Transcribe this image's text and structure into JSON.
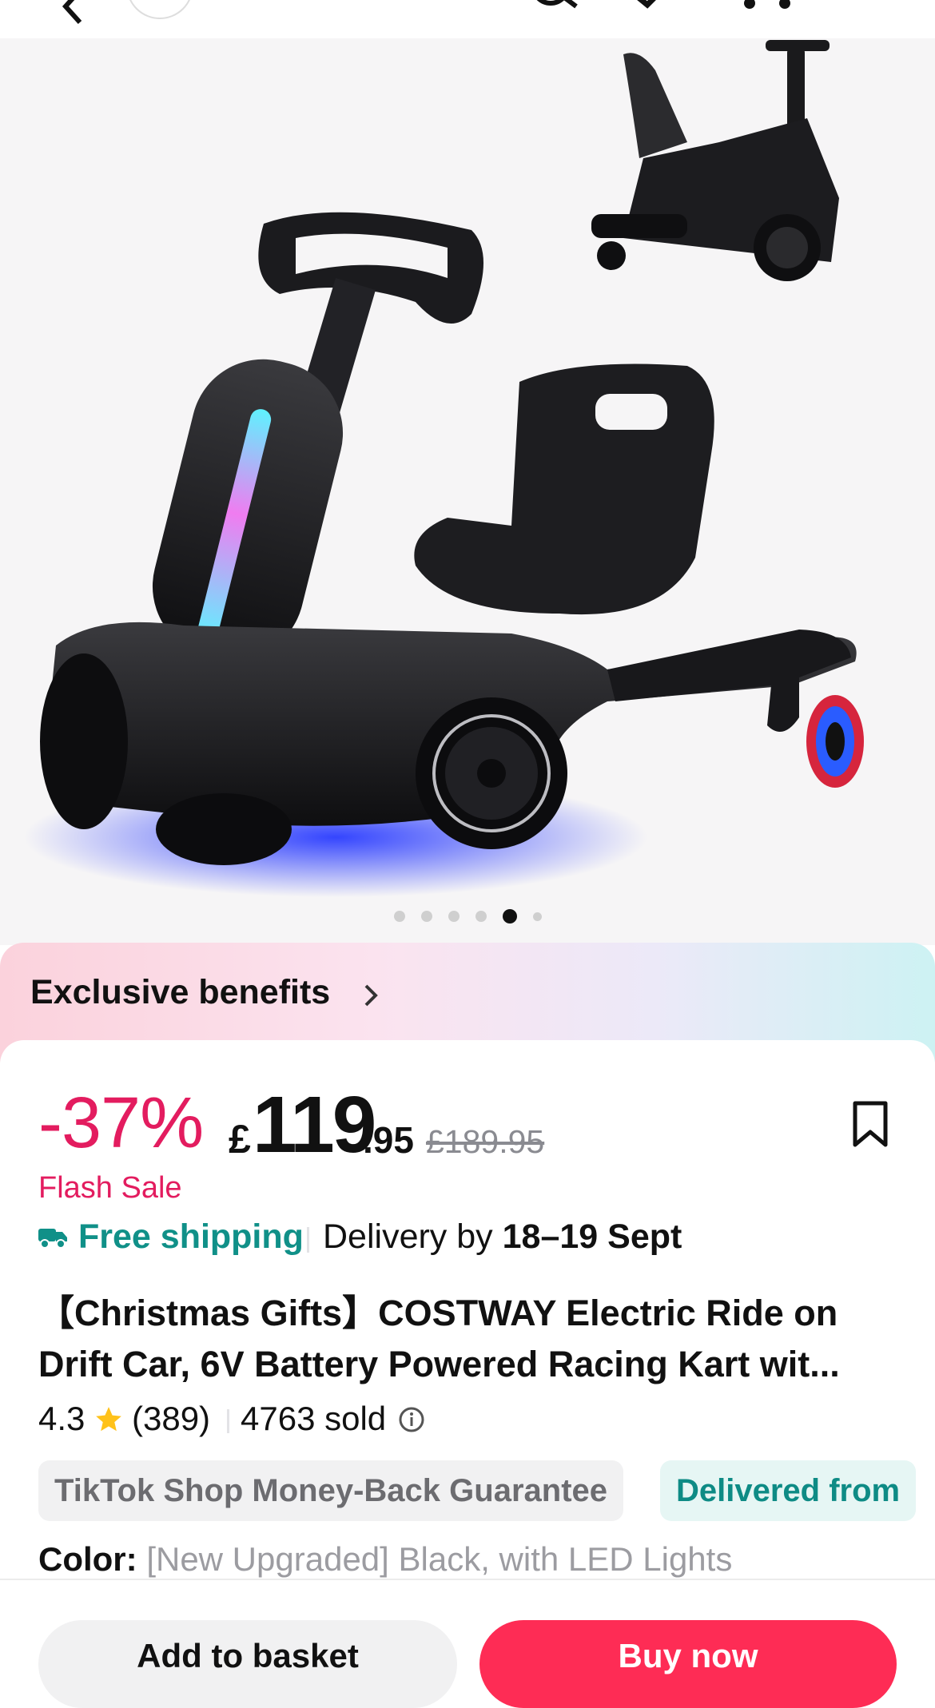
{
  "product": {
    "image_dots": 6,
    "active_dot": 5,
    "benefits_label": "Exclusive benefits",
    "discount": "-37%",
    "currency": "£",
    "price_int": "119",
    "price_dec": ".95",
    "original_price": "£189.95",
    "flash_sale": "Flash Sale",
    "free_shipping": "Free shipping",
    "delivery_prefix": "Delivery by ",
    "delivery_dates": "18–19 Sept",
    "title": "【Christmas Gifts】COSTWAY Electric Ride on Drift Car, 6V Battery Powered Racing Kart wit...",
    "rating": "4.3",
    "reviews": "(389)",
    "sold": "4763 sold",
    "tag_guarantee": "TikTok Shop Money-Back Guarantee",
    "tag_delivered": "Delivered from",
    "color_label": "Color:",
    "color_value": "[New Upgraded] Black, with LED Lights"
  },
  "actions": {
    "add_to_basket": "Add to basket",
    "buy_now": "Buy now"
  },
  "colors": {
    "accent": "#fe2c55",
    "discount": "#e31c5f",
    "teal": "#109088"
  },
  "icons": [
    "back-icon",
    "search-icon",
    "share-icon",
    "more-icon",
    "chevron-right-icon",
    "bookmark-icon",
    "truck-icon",
    "star-icon",
    "info-icon"
  ]
}
